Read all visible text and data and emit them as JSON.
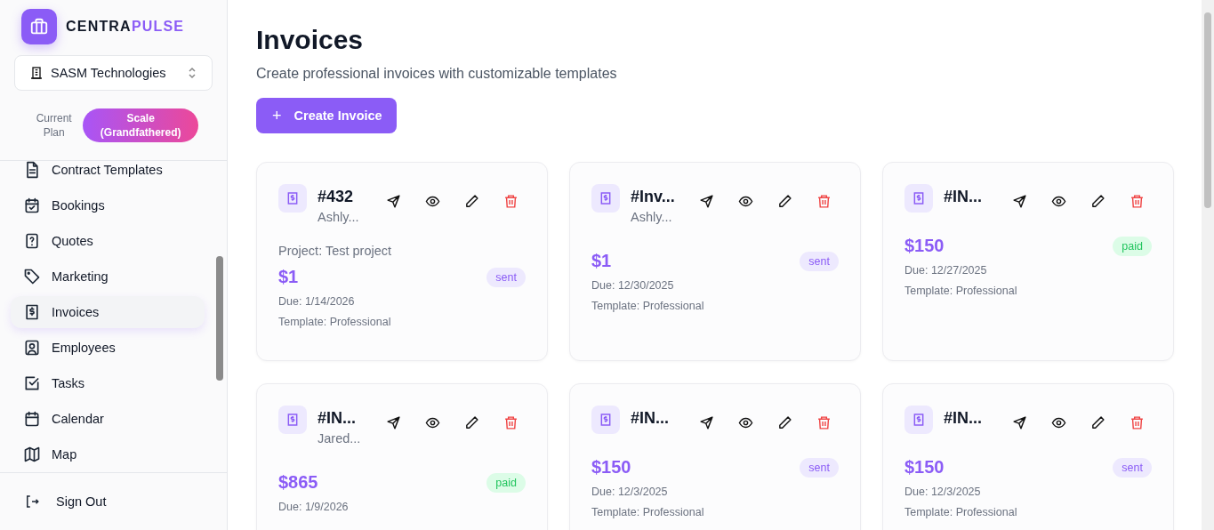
{
  "brand": {
    "first": "CENTRA",
    "second": "PULSE"
  },
  "org_selector": {
    "value": "SASM Technologies"
  },
  "plan": {
    "label": "Current Plan",
    "badge": "Scale (Grandfathered)"
  },
  "sidebar": {
    "items": [
      {
        "label": "Contract Templates",
        "selected": false
      },
      {
        "label": "Bookings",
        "selected": false
      },
      {
        "label": "Quotes",
        "selected": false
      },
      {
        "label": "Marketing",
        "selected": false
      },
      {
        "label": "Invoices",
        "selected": true
      },
      {
        "label": "Employees",
        "selected": false
      },
      {
        "label": "Tasks",
        "selected": false
      },
      {
        "label": "Calendar",
        "selected": false
      },
      {
        "label": "Map",
        "selected": false
      }
    ],
    "sign_out": "Sign Out"
  },
  "page": {
    "title": "Invoices",
    "subtitle": "Create professional invoices with customizable templates",
    "create_button": "+ Create Invoice"
  },
  "invoices": [
    {
      "number": "#432",
      "client": "Ashly...",
      "project": "Project: Test project",
      "amount": "$1",
      "status": "sent",
      "kind": "sent",
      "due": "Due: 1/14/2026",
      "template": "Template: Professional"
    },
    {
      "number": "#Inv...",
      "client": "Ashly...",
      "amount": "$1",
      "status": "sent",
      "kind": "sent",
      "due": "Due: 12/30/2025",
      "template": "Template: Professional"
    },
    {
      "number": "#IN...",
      "amount": "$150",
      "status": "paid",
      "kind": "paid",
      "due": "Due: 12/27/2025",
      "template": "Template: Professional"
    },
    {
      "number": "#IN...",
      "client": "Jared...",
      "amount": "$865",
      "status": "paid",
      "kind": "paid",
      "due": "Due: 1/9/2026"
    },
    {
      "number": "#IN...",
      "amount": "$150",
      "status": "sent",
      "kind": "sent",
      "due": "Due: 12/3/2025",
      "template": "Template: Professional"
    },
    {
      "number": "#IN...",
      "amount": "$150",
      "status": "sent",
      "kind": "sent",
      "due": "Due: 12/3/2025",
      "template": "Template: Professional"
    }
  ]
}
